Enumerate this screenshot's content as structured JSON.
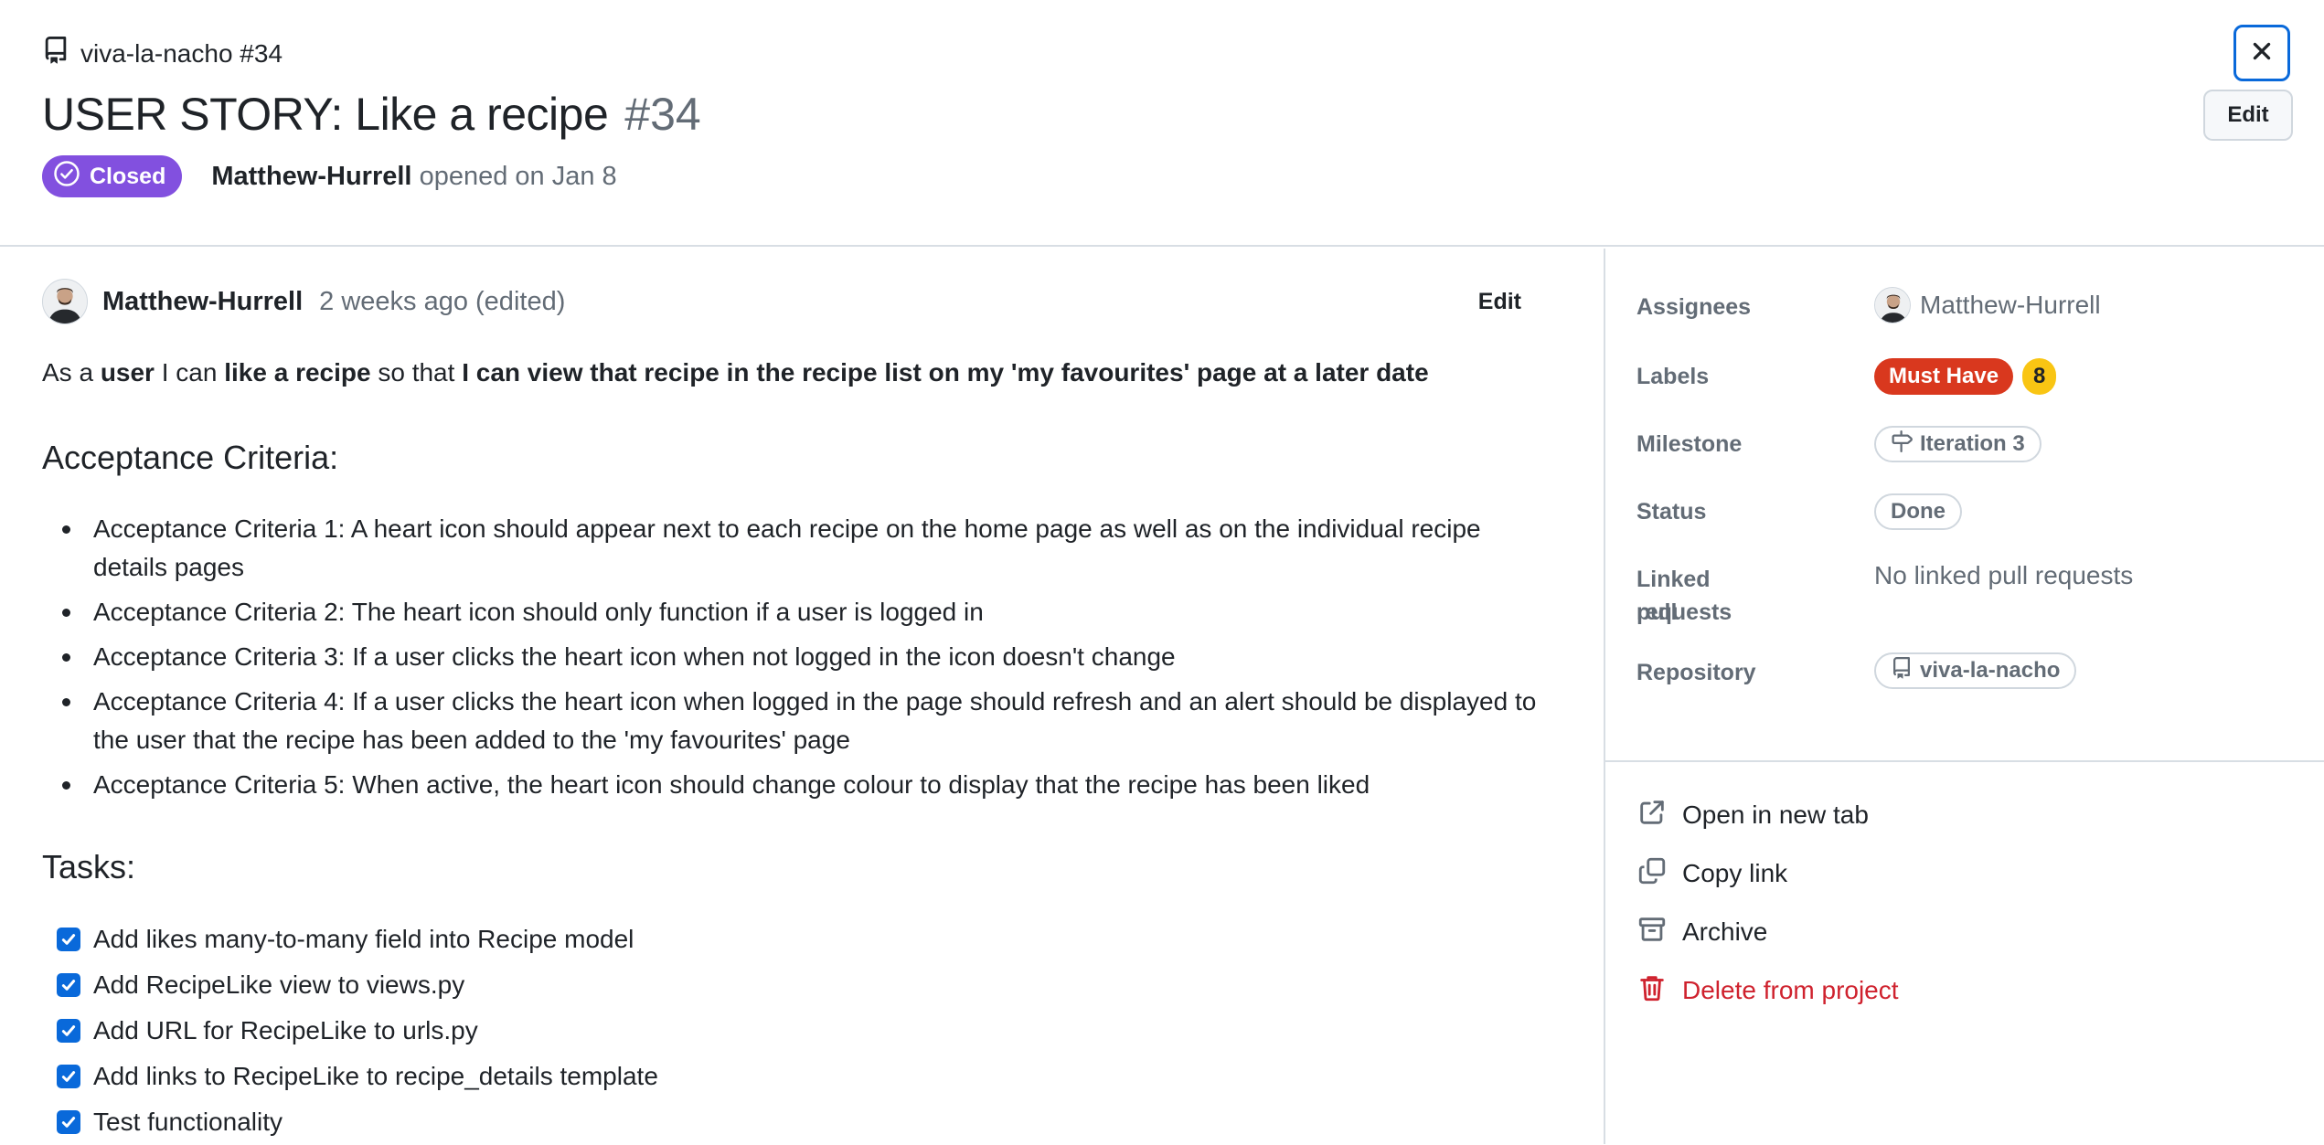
{
  "header": {
    "repo_ref": "viva-la-nacho #34",
    "title": "USER STORY: Like a recipe",
    "number": "#34",
    "state": "Closed",
    "author": "Matthew-Hurrell",
    "opened_text": "opened on Jan 8",
    "edit_label": "Edit"
  },
  "comment": {
    "author": "Matthew-Hurrell",
    "time": "2 weeks ago (edited)",
    "edit_label": "Edit",
    "story": {
      "p1": "As a ",
      "b1": "user",
      "p2": " I can ",
      "b2": "like a recipe",
      "p3": " so that ",
      "b3": "I can view that recipe in the recipe list on my 'my favourites' page at a later date"
    },
    "acceptance_heading": "Acceptance Criteria:",
    "criteria": [
      "Acceptance Criteria 1: A heart icon should appear next to each recipe on the home page as well as on the individual recipe details pages",
      "Acceptance Criteria 2: The heart icon should only function if a user is logged in",
      "Acceptance Criteria 3: If a user clicks the heart icon when not logged in the icon doesn't change",
      "Acceptance Criteria 4: If a user clicks the heart icon when logged in the page should refresh and an alert should be displayed to the user that the recipe has been added to the 'my favourites' page",
      "Acceptance Criteria 5: When active, the heart icon should change colour to display that the recipe has been liked"
    ],
    "tasks_heading": "Tasks:",
    "tasks": [
      "Add likes many-to-many field into Recipe model",
      "Add RecipeLike view to views.py",
      "Add URL for RecipeLike to urls.py",
      "Add links to RecipeLike to recipe_details template",
      "Test functionality"
    ]
  },
  "sidebar": {
    "assignees_label": "Assignees",
    "assignee": "Matthew-Hurrell",
    "labels_label": "Labels",
    "label_must_have": "Must Have",
    "label_points": "8",
    "milestone_label": "Milestone",
    "milestone": "Iteration 3",
    "status_label": "Status",
    "status": "Done",
    "linked_label_1": "Linked pull",
    "linked_label_2": "requests",
    "linked_value": "No linked pull requests",
    "repository_label": "Repository",
    "repository": "viva-la-nacho",
    "actions": {
      "open_new_tab": "Open in new tab",
      "copy_link": "Copy link",
      "archive": "Archive",
      "delete": "Delete from project"
    }
  },
  "colors": {
    "closed_badge": "#8250df",
    "must_have": "#d9381e",
    "points": "#f9c513",
    "accent": "#0969da",
    "danger": "#cf222e"
  },
  "icons": [
    "repo-icon",
    "close-icon",
    "check-circle-icon",
    "checkbox-checked-icon",
    "milestone-icon",
    "link-external-icon",
    "copy-icon",
    "archive-icon",
    "trash-icon"
  ]
}
